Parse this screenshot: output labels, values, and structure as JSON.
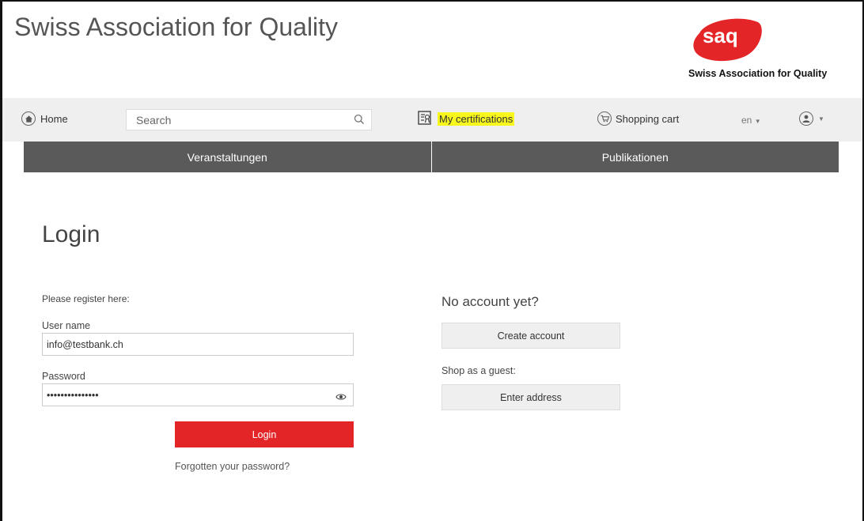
{
  "header": {
    "site_title": "Swiss Association for Quality",
    "logo_text": "saq",
    "logo_caption": "Swiss Association for Quality",
    "brand_color": "#e42528"
  },
  "navbar": {
    "home_label": "Home",
    "home_icon": "home-icon",
    "search_placeholder": "Search",
    "search_icon": "search-icon",
    "certifications_label": "My certifications",
    "certifications_icon": "certificate-icon",
    "certifications_highlight": "#f7f71e",
    "cart_label": "Shopping cart",
    "cart_icon": "shopping-cart-icon",
    "language": "en",
    "user_icon": "user-icon"
  },
  "menu": {
    "items": [
      {
        "label": "Veranstaltungen"
      },
      {
        "label": "Publikationen"
      }
    ],
    "background": "#595a59"
  },
  "login": {
    "title": "Login",
    "register_text": "Please register here:",
    "username_label": "User name",
    "username_value": "info@testbank.ch",
    "password_label": "Password",
    "password_value": "•••••••••••••••",
    "login_button": "Login",
    "forgot_link": "Forgotten your password?"
  },
  "signup": {
    "heading": "No account yet?",
    "create_button": "Create account",
    "guest_text": "Shop as a guest:",
    "address_button": "Enter address"
  }
}
